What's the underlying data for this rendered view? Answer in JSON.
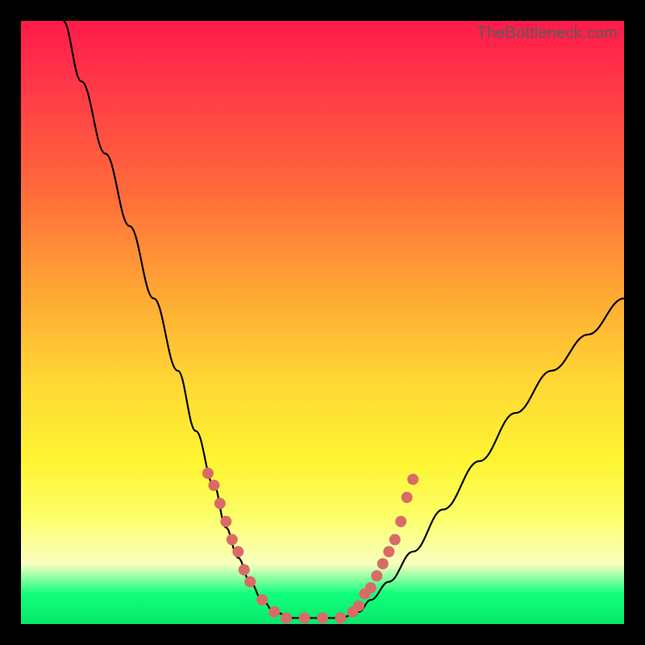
{
  "watermark": "TheBottleneck.com",
  "colors": {
    "background_border": "#000000",
    "gradient_top": "#ff1a4b",
    "gradient_bottom": "#08e86a",
    "curve": "#000000",
    "marker": "#d96b66",
    "watermark_text": "#5a5a5a"
  },
  "chart_data": {
    "type": "line",
    "title": "",
    "xlabel": "",
    "ylabel": "",
    "xlim": [
      0,
      100
    ],
    "ylim": [
      0,
      100
    ],
    "note": "Axes are unlabeled; x and y are normalized 0–100 from pixel positions. y represents vertical position (0 = bottom band, 100 = top).",
    "series": [
      {
        "name": "bottleneck-curve",
        "x": [
          7,
          10,
          14,
          18,
          22,
          26,
          29,
          32,
          34,
          36,
          38,
          40,
          42,
          45,
          49,
          53,
          56,
          58,
          61,
          65,
          70,
          76,
          82,
          88,
          94,
          100
        ],
        "y": [
          100,
          90,
          78,
          66,
          54,
          42,
          32,
          23,
          16,
          11,
          7,
          4,
          2,
          1,
          1,
          1,
          2,
          4,
          7,
          12,
          19,
          27,
          35,
          42,
          48,
          54
        ]
      }
    ],
    "markers": {
      "name": "highlighted-points",
      "points_xy": [
        [
          31,
          25
        ],
        [
          32,
          23
        ],
        [
          33,
          20
        ],
        [
          34,
          17
        ],
        [
          35,
          14
        ],
        [
          36,
          12
        ],
        [
          37,
          9
        ],
        [
          38,
          7
        ],
        [
          40,
          4
        ],
        [
          42,
          2
        ],
        [
          44,
          1
        ],
        [
          47,
          1
        ],
        [
          50,
          1
        ],
        [
          53,
          1
        ],
        [
          55,
          2
        ],
        [
          56,
          3
        ],
        [
          57,
          5
        ],
        [
          58,
          6
        ],
        [
          59,
          8
        ],
        [
          60,
          10
        ],
        [
          61,
          12
        ],
        [
          62,
          14
        ],
        [
          63,
          17
        ],
        [
          64,
          21
        ],
        [
          65,
          24
        ]
      ]
    }
  }
}
